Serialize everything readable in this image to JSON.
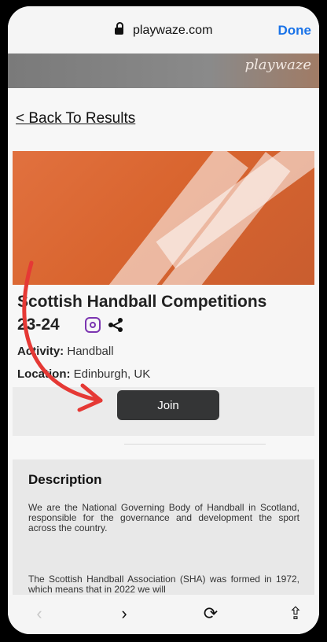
{
  "browser": {
    "url": "playwaze.com",
    "done_label": "Done"
  },
  "banner": {
    "logo_text": "playwaze"
  },
  "page": {
    "back_link": "< Back To Results",
    "title_line1": "Scottish Handball Competitions",
    "title_line2": "23-24",
    "activity_label": "Activity:",
    "activity_value": "Handball",
    "location_label": "Location:",
    "location_value": "Edinburgh, UK",
    "join_label": "Join",
    "description_title": "Description",
    "description_p1": "We are the National Governing Body of Handball in Scotland, responsible for the governance and development the sport across the country.",
    "description_p2": "The Scottish Handball Association (SHA) was formed in 1972, which means that in 2022 we will"
  },
  "bottom_nav": {
    "back_icon": "chevron-left-icon",
    "forward_icon": "chevron-right-icon",
    "reload_icon": "reload-icon",
    "share_icon": "share-icon"
  },
  "colors": {
    "accent": "#1a73e8",
    "hero": "#e1713f",
    "join_button": "#343536",
    "arrow": "#e53935",
    "instagram": "#7b35b1"
  }
}
